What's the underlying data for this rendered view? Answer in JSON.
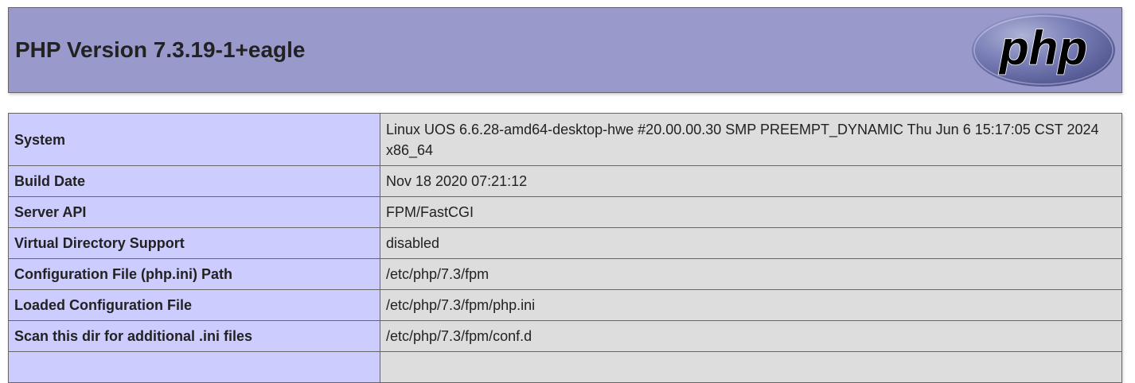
{
  "header": {
    "title": "PHP Version 7.3.19-1+eagle",
    "logo_text": "php"
  },
  "rows": [
    {
      "key": "System",
      "value": "Linux UOS 6.6.28-amd64-desktop-hwe #20.00.00.30 SMP PREEMPT_DYNAMIC Thu Jun 6 15:17:05 CST 2024 x86_64"
    },
    {
      "key": "Build Date",
      "value": "Nov 18 2020 07:21:12"
    },
    {
      "key": "Server API",
      "value": "FPM/FastCGI"
    },
    {
      "key": "Virtual Directory Support",
      "value": "disabled"
    },
    {
      "key": "Configuration File (php.ini) Path",
      "value": "/etc/php/7.3/fpm"
    },
    {
      "key": "Loaded Configuration File",
      "value": "/etc/php/7.3/fpm/php.ini"
    },
    {
      "key": "Scan this dir for additional .ini files",
      "value": "/etc/php/7.3/fpm/conf.d"
    },
    {
      "key": "",
      "value": ""
    }
  ],
  "colors": {
    "header_bg": "#9999cc",
    "key_bg": "#ccccff",
    "value_bg": "#dddddd",
    "border": "#666666"
  },
  "icons": {
    "logo": "php-logo-icon"
  }
}
